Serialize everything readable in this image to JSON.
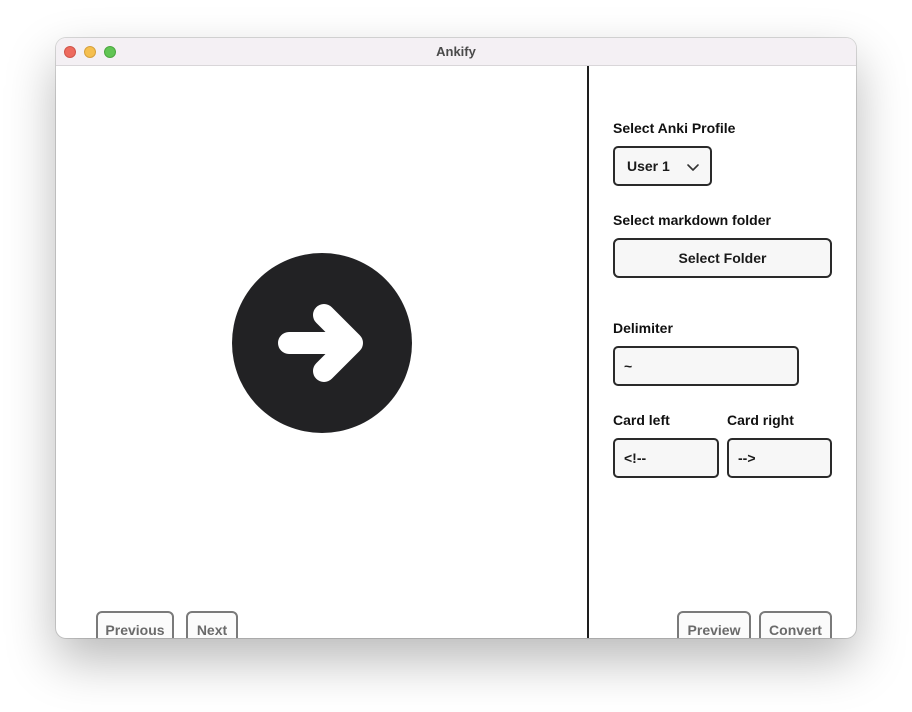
{
  "window": {
    "title": "Ankify"
  },
  "left": {
    "center_icon": "arrow-right-circle-icon",
    "previous_label": "Previous",
    "next_label": "Next"
  },
  "settings": {
    "profile_label": "Select Anki Profile",
    "profile_value": "User 1",
    "folder_label": "Select markdown folder",
    "folder_button": "Select Folder",
    "delimiter_label": "Delimiter",
    "delimiter_value": "~",
    "card_left_label": "Card left",
    "card_left_value": "<!--",
    "card_right_label": "Card right",
    "card_right_value": "-->",
    "preview_label": "Preview",
    "convert_label": "Convert"
  },
  "colors": {
    "close": "#ed6a5e",
    "minimize": "#f5bf4f",
    "maximize": "#61c554",
    "icon_dark": "#222224"
  }
}
